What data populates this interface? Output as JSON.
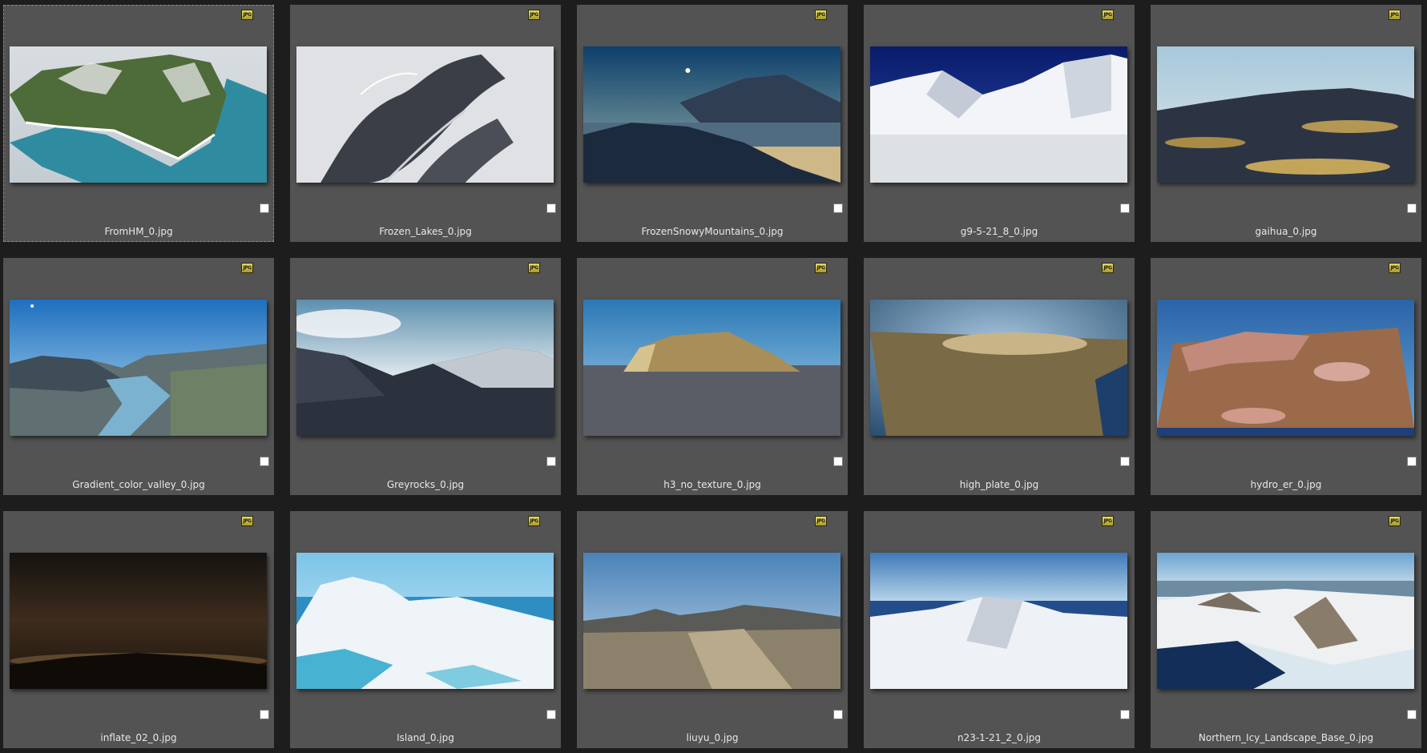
{
  "gallery": {
    "files": [
      {
        "name": "FromHM_0.jpg",
        "badge": "JPG",
        "selected": true
      },
      {
        "name": "Frozen_Lakes_0.jpg",
        "badge": "JPG",
        "selected": false
      },
      {
        "name": "FrozenSnowyMountains_0.jpg",
        "badge": "JPG",
        "selected": false
      },
      {
        "name": "g9-5-21_8_0.jpg",
        "badge": "JPG",
        "selected": false
      },
      {
        "name": "gaihua_0.jpg",
        "badge": "JPG",
        "selected": false
      },
      {
        "name": "Gradient_color_valley_0.jpg",
        "badge": "JPG",
        "selected": false
      },
      {
        "name": "Greyrocks_0.jpg",
        "badge": "JPG",
        "selected": false
      },
      {
        "name": "h3_no_texture_0.jpg",
        "badge": "JPG",
        "selected": false
      },
      {
        "name": "high_plate_0.jpg",
        "badge": "JPG",
        "selected": false
      },
      {
        "name": "hydro_er_0.jpg",
        "badge": "JPG",
        "selected": false
      },
      {
        "name": "inflate_02_0.jpg",
        "badge": "JPG",
        "selected": false
      },
      {
        "name": "Island_0.jpg",
        "badge": "JPG",
        "selected": false
      },
      {
        "name": "liuyu_0.jpg",
        "badge": "JPG",
        "selected": false
      },
      {
        "name": "n23-1-21_2_0.jpg",
        "badge": "JPG",
        "selected": false
      },
      {
        "name": "Northern_Icy_Landscape_Base_0.jpg",
        "badge": "JPG",
        "selected": false
      }
    ]
  }
}
